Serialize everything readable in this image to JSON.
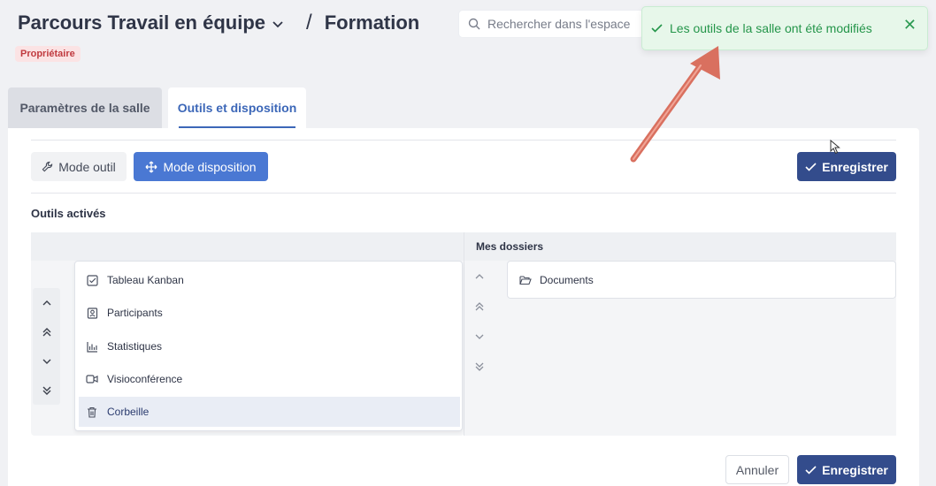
{
  "header": {
    "space_title": "Parcours Travail en équipe",
    "separator": "/",
    "room_title": "Formation",
    "role_badge": "Propriétaire"
  },
  "search": {
    "placeholder": "Rechercher dans l'espace"
  },
  "toast": {
    "message": "Les outils de la salle ont été modifiés",
    "close": "✕"
  },
  "tabs": [
    {
      "label": "Paramètres de la salle",
      "active": false
    },
    {
      "label": "Outils et disposition",
      "active": true
    }
  ],
  "toolbar": {
    "mode_tool": "Mode outil",
    "mode_layout": "Mode disposition",
    "save": "Enregistrer"
  },
  "section": {
    "label": "Outils activés"
  },
  "tools": [
    {
      "label": "Tableau Kanban",
      "icon": "kanban-checkbox-icon",
      "selected": false
    },
    {
      "label": "Participants",
      "icon": "contacts-icon",
      "selected": false
    },
    {
      "label": "Statistiques",
      "icon": "bar-chart-icon",
      "selected": false
    },
    {
      "label": "Visioconférence",
      "icon": "video-camera-icon",
      "selected": false
    },
    {
      "label": "Corbeille",
      "icon": "trash-icon",
      "selected": true
    }
  ],
  "folders": {
    "header": "Mes dossiers",
    "items": [
      {
        "label": "Documents",
        "icon": "folder-open-icon"
      }
    ]
  },
  "arrows": {
    "up": "⌃",
    "top": "︽",
    "down": "⌄",
    "bottom": "︾"
  },
  "footer": {
    "cancel": "Annuler",
    "save": "Enregistrer"
  },
  "colors": {
    "primary": "#334c8c",
    "accent": "#4a78d3",
    "toast_bg": "#e7f7ea",
    "toast_text": "#24954a",
    "badge_bg": "#fbe3e4",
    "badge_text": "#c03a3f",
    "annotation_arrow": "#e07c6c"
  }
}
